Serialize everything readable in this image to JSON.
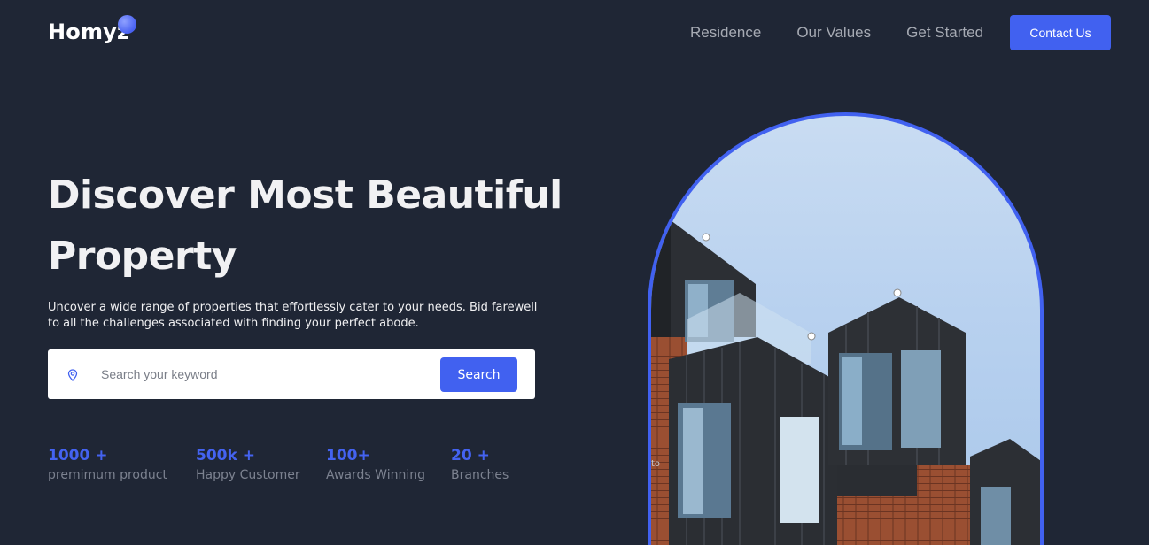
{
  "brand": {
    "name": "Homyz"
  },
  "nav": {
    "items": [
      "Residence",
      "Our Values",
      "Get Started"
    ],
    "cta": "Contact Us"
  },
  "hero": {
    "title": "Discover Most Beautiful Property",
    "description": "Uncover a wide range of properties that effortlessly cater to your needs. Bid farewell to all the challenges associated with finding your perfect abode."
  },
  "search": {
    "icon": "location-pin-icon",
    "placeholder": "Search your keyword",
    "button_label": "Search"
  },
  "stats": [
    {
      "value": "1000 +",
      "label": "premimum product"
    },
    {
      "value": "500k +",
      "label": "Happy Customer"
    },
    {
      "value": "100+",
      "label": "Awards Winning"
    },
    {
      "value": "20 +",
      "label": "Branches"
    }
  ],
  "image": {
    "caption_fragment": "to"
  },
  "colors": {
    "background": "#1f2635",
    "accent": "#4161f0",
    "stat_value": "#4463f1",
    "muted": "#7c8290"
  }
}
